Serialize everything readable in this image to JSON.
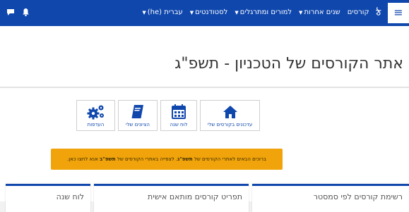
{
  "navbar": {
    "hamburger_icon": "menu-icon",
    "logo_text": "ঠ",
    "items": [
      {
        "label": "קורסים",
        "has_dropdown": false
      },
      {
        "label": "שנים אחרות",
        "has_dropdown": true
      },
      {
        "label": "למורים ומתרגלים",
        "has_dropdown": true
      },
      {
        "label": "לסטודנטים",
        "has_dropdown": true
      },
      {
        "label": "עברית (he)",
        "has_dropdown": true
      }
    ],
    "left_icons": [
      "chat-icon",
      "bell-icon"
    ],
    "colors": {
      "bar": "#0f47ad",
      "text": "#ffffff"
    }
  },
  "page": {
    "title": "אתר הקורסים של הטכניון - תשפ\"ג"
  },
  "tiles": [
    {
      "label": "עדכונים בקורסים שלי",
      "icon": "home-icon"
    },
    {
      "label": "לוח שנה",
      "icon": "calendar-icon"
    },
    {
      "label": "הציונים שלי",
      "icon": "gradebook-icon"
    },
    {
      "label": "העדפות",
      "icon": "gears-icon"
    }
  ],
  "notice": {
    "prefix": "ברוכים הבאים לאתרי הקורסים של",
    "year_current": "תשפ\"ג",
    "middle": ". לצפייה באתרי הקורסים של",
    "year_previous": "תשפ\"ב",
    "suffix": "אנא לחצו כאן.",
    "color": "#f0a30a"
  },
  "cards": [
    {
      "title": "רשימת קורסים לפי סמסטר"
    },
    {
      "title": "תפריט קורסים מותאם אישית"
    },
    {
      "title": "לוח שנה"
    }
  ]
}
